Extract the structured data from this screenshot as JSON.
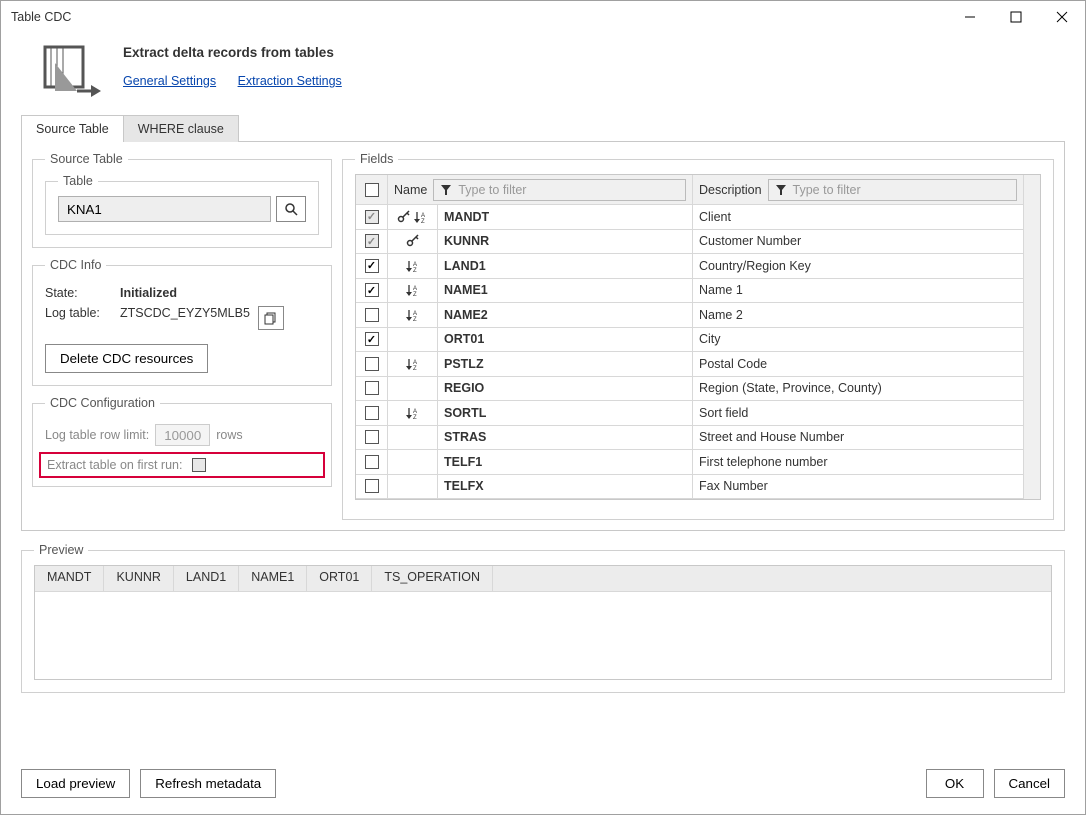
{
  "window": {
    "title": "Table CDC"
  },
  "header": {
    "title": "Extract delta records from tables",
    "link_general": "General Settings",
    "link_extraction": "Extraction Settings"
  },
  "tabs": {
    "source_table": "Source Table",
    "where_clause": "WHERE clause"
  },
  "source": {
    "fieldset": "Source Table",
    "table_label": "Table",
    "table_value": "KNA1"
  },
  "cdc_info": {
    "fieldset": "CDC Info",
    "state_label": "State:",
    "state_value": "Initialized",
    "log_label": "Log table:",
    "log_value": "ZTSCDC_EYZY5MLB5",
    "delete_btn": "Delete CDC resources"
  },
  "cdc_config": {
    "fieldset": "CDC Configuration",
    "row_limit_label": "Log table row limit:",
    "row_limit_value": "10000",
    "row_limit_unit": "rows",
    "extract_first_label": "Extract table on first run:"
  },
  "fields": {
    "fieldset": "Fields",
    "col_name": "Name",
    "col_desc": "Description",
    "filter_placeholder": "Type to filter",
    "rows": [
      {
        "checked": true,
        "disabledCheck": true,
        "key": true,
        "sort": true,
        "name": "MANDT",
        "desc": "Client",
        "bold": true
      },
      {
        "checked": true,
        "disabledCheck": true,
        "key": true,
        "sort": false,
        "name": "KUNNR",
        "desc": "Customer Number",
        "bold": true
      },
      {
        "checked": true,
        "disabledCheck": false,
        "key": false,
        "sort": true,
        "name": "LAND1",
        "desc": "Country/Region Key",
        "bold": true
      },
      {
        "checked": true,
        "disabledCheck": false,
        "key": false,
        "sort": true,
        "name": "NAME1",
        "desc": "Name 1",
        "bold": true
      },
      {
        "checked": false,
        "disabledCheck": false,
        "key": false,
        "sort": true,
        "name": "NAME2",
        "desc": "Name 2",
        "bold": true
      },
      {
        "checked": true,
        "disabledCheck": false,
        "key": false,
        "sort": false,
        "name": "ORT01",
        "desc": "City",
        "bold": true
      },
      {
        "checked": false,
        "disabledCheck": false,
        "key": false,
        "sort": true,
        "name": "PSTLZ",
        "desc": "Postal Code",
        "bold": true
      },
      {
        "checked": false,
        "disabledCheck": false,
        "key": false,
        "sort": false,
        "name": "REGIO",
        "desc": "Region (State, Province, County)",
        "bold": true
      },
      {
        "checked": false,
        "disabledCheck": false,
        "key": false,
        "sort": true,
        "name": "SORTL",
        "desc": "Sort field",
        "bold": true
      },
      {
        "checked": false,
        "disabledCheck": false,
        "key": false,
        "sort": false,
        "name": "STRAS",
        "desc": "Street and House Number",
        "bold": true
      },
      {
        "checked": false,
        "disabledCheck": false,
        "key": false,
        "sort": false,
        "name": "TELF1",
        "desc": "First telephone number",
        "bold": true
      },
      {
        "checked": false,
        "disabledCheck": false,
        "key": false,
        "sort": false,
        "name": "TELFX",
        "desc": "Fax Number",
        "bold": true
      }
    ]
  },
  "preview": {
    "fieldset": "Preview",
    "columns": [
      "MANDT",
      "KUNNR",
      "LAND1",
      "NAME1",
      "ORT01",
      "TS_OPERATION"
    ]
  },
  "footer": {
    "load_preview": "Load preview",
    "refresh_metadata": "Refresh metadata",
    "ok": "OK",
    "cancel": "Cancel"
  }
}
